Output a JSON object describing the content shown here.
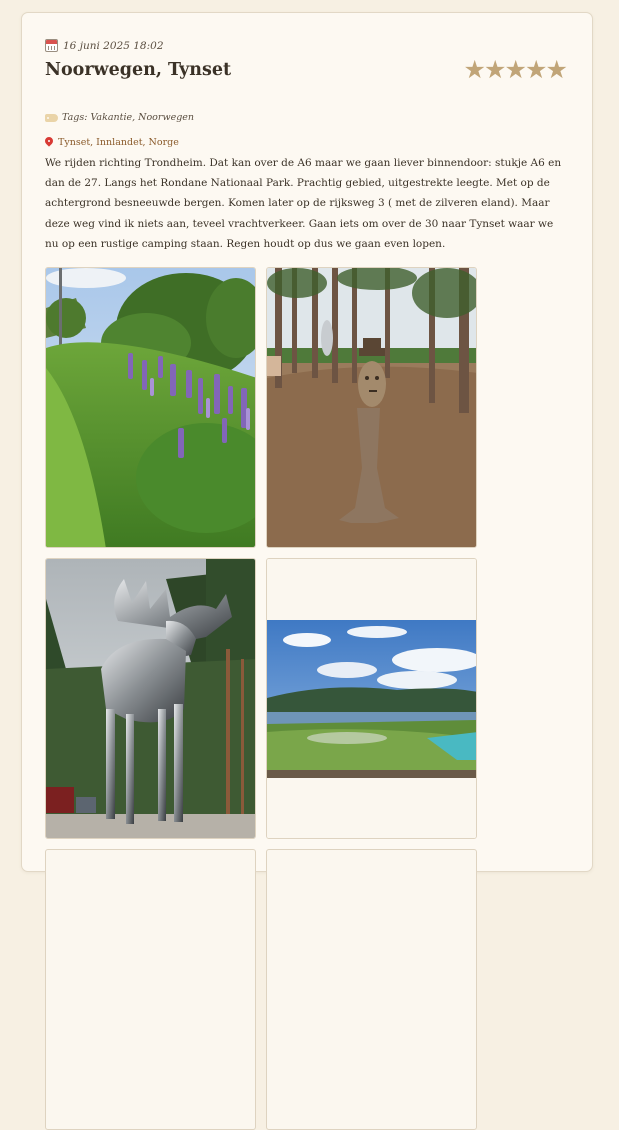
{
  "entry": {
    "date": "16 juni 2025 18:02",
    "title": "Noorwegen, Tynset",
    "rating": 5,
    "rating_stars": [
      "★",
      "★",
      "★",
      "★",
      "★"
    ],
    "tags_label": "Tags: Vakantie, Noorwegen",
    "location": "Tynset, Innlandet, Norge",
    "body": "We rijden richting Trondheim. Dat kan over de A6 maar we gaan liever binnendoor: stukje A6 en dan de 27. Langs het Rondane Nationaal Park. Prachtig gebied, uitgestrekte leegte. Met op de achtergrond besneeuwde bergen. Komen later op de rijksweg 3 ( met de zilveren eland). Maar deze weg vind ik niets aan, teveel vrachtverkeer. Gaan iets om over de 30 naar Tynset waar we nu op een rustige camping staan. Regen houdt op dus we gaan even lopen."
  },
  "icons": {
    "date": "calendar-icon",
    "tags": "tag-icon",
    "location": "pin-icon",
    "rating": "star-icon"
  },
  "colors": {
    "page_bg": "#f7f0e3",
    "card_bg": "#fdf9f2",
    "star": "#c1a578",
    "location_text": "#8a5a2a",
    "pin": "#d83a34"
  },
  "photos": [
    {
      "subject": "lupine-flowers-roadside"
    },
    {
      "subject": "wood-carved-figure-forest"
    },
    {
      "subject": "silver-moose-statue"
    },
    {
      "subject": "lake-valley-minigolf"
    }
  ]
}
